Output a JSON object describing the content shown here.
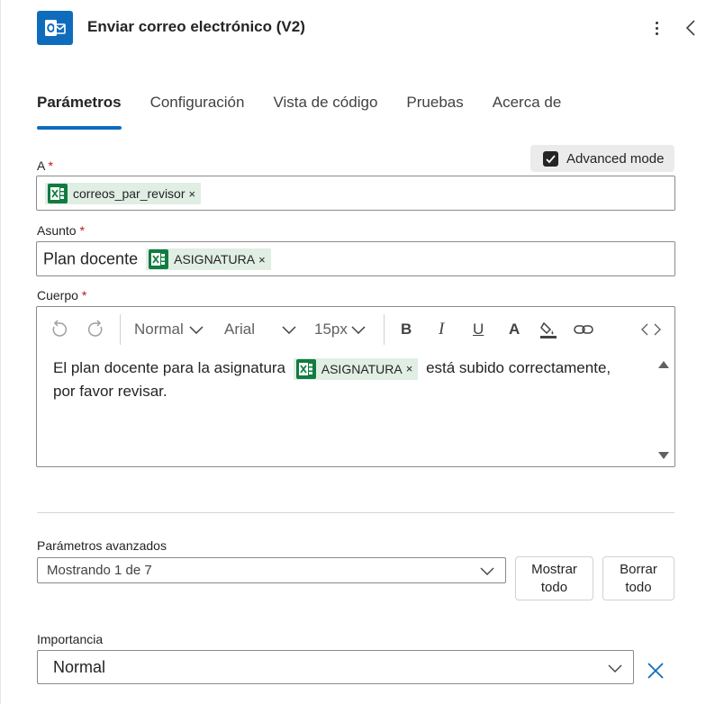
{
  "header": {
    "title": "Enviar correo electrónico (V2)",
    "app_icon": "outlook-icon",
    "more_icon": "more-vertical-icon",
    "collapse_icon": "chevron-left-icon"
  },
  "tabs": [
    {
      "label": "Parámetros",
      "active": true
    },
    {
      "label": "Configuración",
      "active": false
    },
    {
      "label": "Vista de código",
      "active": false
    },
    {
      "label": "Pruebas",
      "active": false
    },
    {
      "label": "Acerca de",
      "active": false
    }
  ],
  "advanced_mode": {
    "label": "Advanced mode",
    "checked": true
  },
  "fields": {
    "to": {
      "label": "A",
      "required": "*",
      "token": "correos_par_revisor"
    },
    "subject": {
      "label": "Asunto",
      "required": "*",
      "text": "Plan docente",
      "token": "ASIGNATURA"
    },
    "body": {
      "label": "Cuerpo",
      "required": "*",
      "toolbar": {
        "style": "Normal",
        "font": "Arial",
        "size": "15px"
      },
      "text_before": "El plan docente para la asignatura",
      "token": "ASIGNATURA",
      "text_after": "está subido correctamente,",
      "text_line2": "por favor revisar."
    }
  },
  "advanced_params": {
    "label": "Parámetros avanzados",
    "select_value": "Mostrando 1 de 7",
    "show_all": "Mostrar todo",
    "clear_all": "Borrar todo"
  },
  "importance": {
    "label": "Importancia",
    "value": "Normal"
  },
  "colors": {
    "accent": "#0f6cbd",
    "token_bg": "#e0eee4",
    "excel_green": "#107c41",
    "required": "#c50f1f"
  }
}
